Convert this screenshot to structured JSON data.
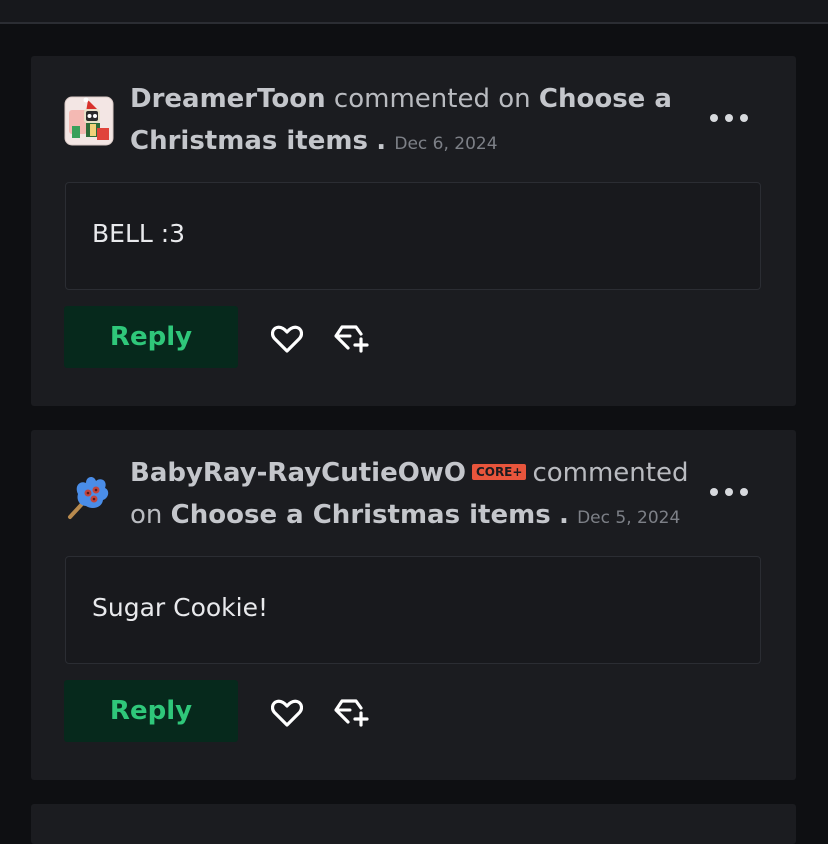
{
  "comments": [
    {
      "username": "DreamerToon",
      "badge": "",
      "action_text": "commented on",
      "post_title": "Choose a Christmas items",
      "separator": ".",
      "date": "Dec 6, 2024",
      "body": "BELL :3",
      "reply_label": "Reply",
      "avatar_icon": "christmas-character-avatar-icon"
    },
    {
      "username": "BabyRay-RayCutieOwO",
      "badge": "CORE+",
      "action_text": "commented",
      "action_text_2": "on",
      "post_title": "Choose a Christmas items",
      "separator": ".",
      "date": "Dec 5, 2024",
      "body": "Sugar Cookie!",
      "reply_label": "Reply",
      "avatar_icon": "blue-glove-lollipop-avatar-icon"
    }
  ],
  "colors": {
    "accent_green": "#2fc77a",
    "reply_bg": "#06291c",
    "core_badge": "#e8553c",
    "card_bg": "#1b1c20",
    "page_bg": "#0e0f12"
  },
  "icons": [
    "more-options-icon",
    "heart-icon",
    "gift-plus-icon"
  ]
}
